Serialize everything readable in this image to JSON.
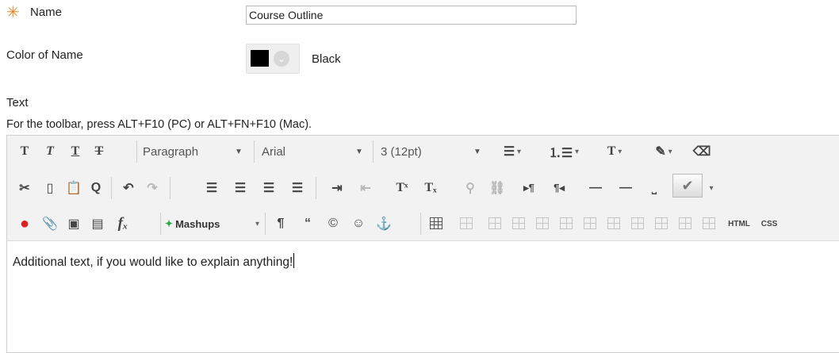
{
  "form": {
    "name_label": "Name",
    "name_value": "Course Outline",
    "color_label": "Color of Name",
    "color_value": "Black",
    "color_swatch": "#000000",
    "text_label": "Text",
    "toolbar_help": "For the toolbar, press ALT+F10 (PC) or ALT+FN+F10 (Mac)."
  },
  "toolbar": {
    "paragraph_select": "Paragraph",
    "font_select": "Arial",
    "size_select": "3 (12pt)",
    "mashups_label": "Mashups",
    "html_label": "HTML",
    "css_label": "CSS"
  },
  "editor": {
    "content": "Additional text, if you would like to explain anything!"
  }
}
